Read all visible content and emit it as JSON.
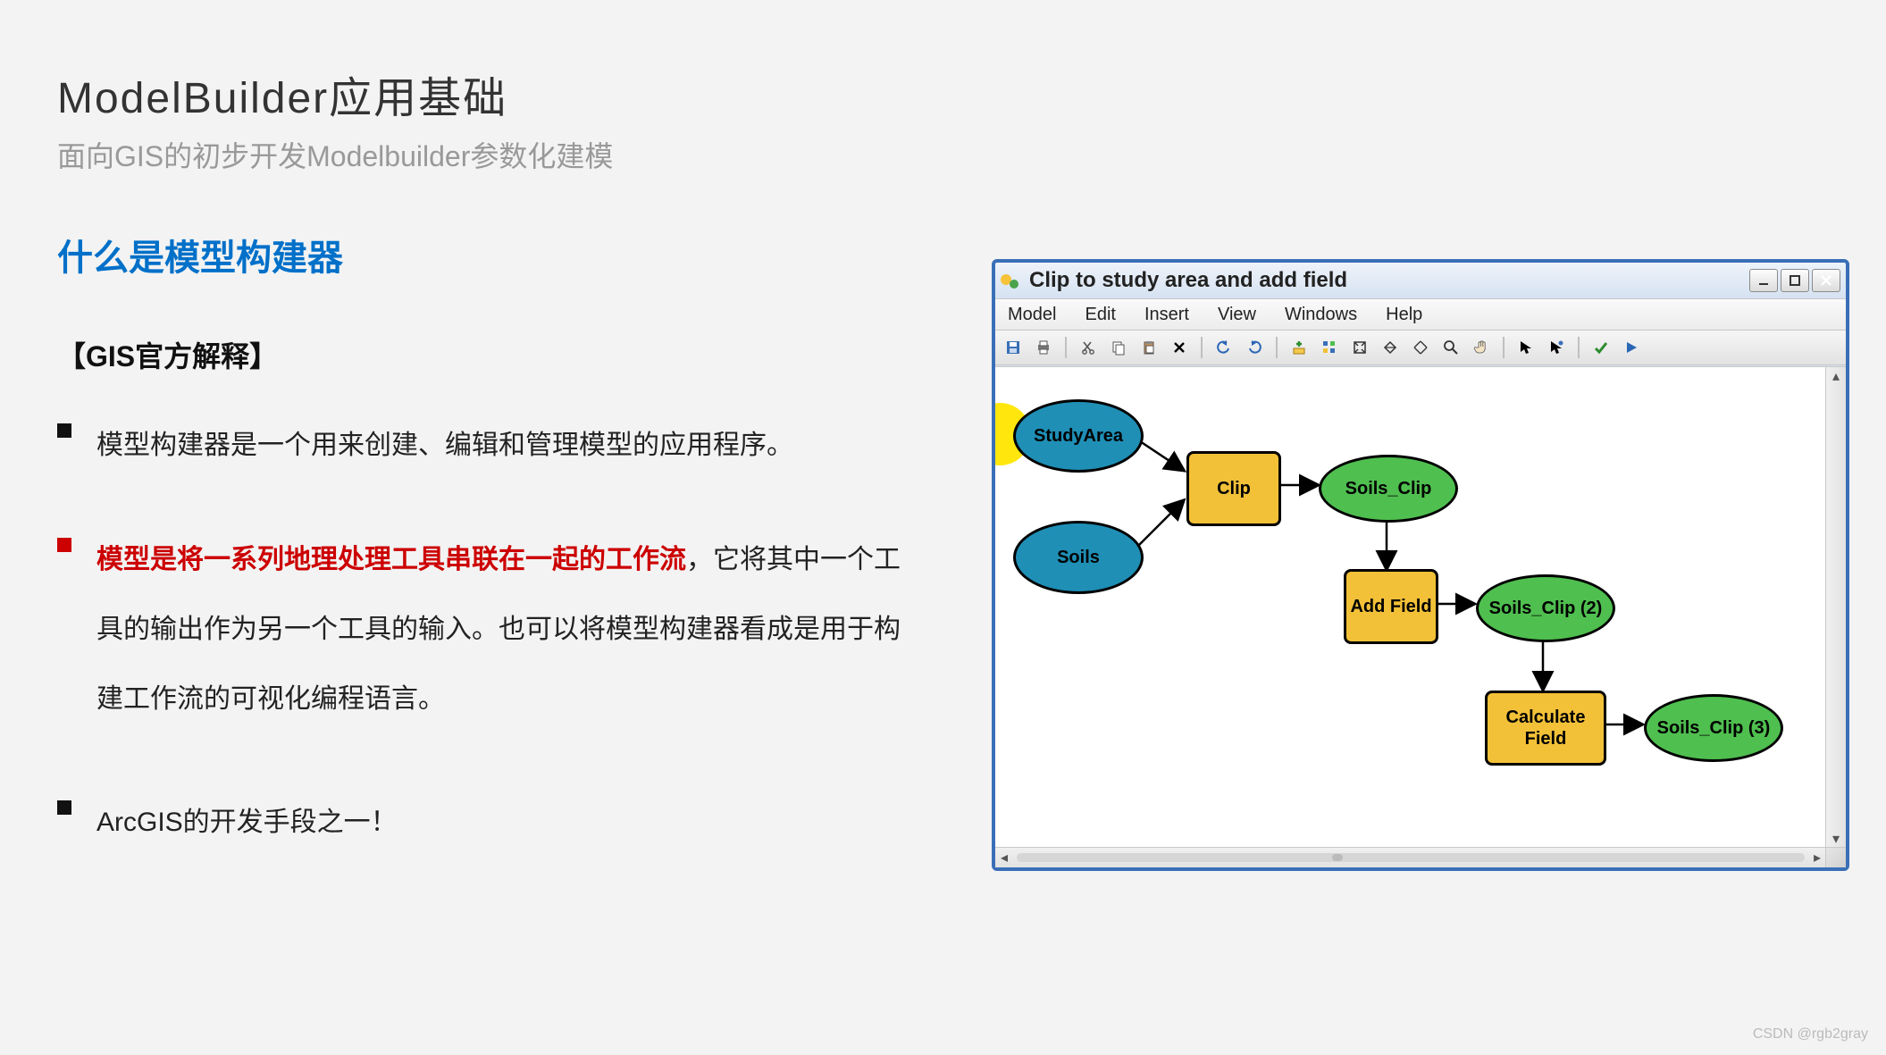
{
  "slide": {
    "main_title": "ModelBuilder应用基础",
    "subtitle": "面向GIS的初步开发Modelbuilder参数化建模",
    "section_title": "什么是模型构建器",
    "sub_section": "【GIS官方解释】",
    "bullets": {
      "b1": "模型构建器是一个用来创建、编辑和管理模型的应用程序。",
      "b2_hl": "模型是将一系列地理处理工具串联在一起的工作流",
      "b2_rest": "，它将其中一个工具的输出作为另一个工具的输入。也可以将模型构建器看成是用于构建工作流的可视化编程语言。",
      "b3": "ArcGIS的开发手段之一！"
    }
  },
  "mb": {
    "window_title": "Clip to study area and add field",
    "menus": [
      "Model",
      "Edit",
      "Insert",
      "View",
      "Windows",
      "Help"
    ],
    "toolbar_icons": [
      "save-icon",
      "print-icon",
      "cut-icon",
      "copy-icon",
      "paste-icon",
      "delete-icon",
      "undo-icon",
      "redo-icon",
      "add-data-icon",
      "auto-layout-icon",
      "full-extent-icon",
      "fixed-zoom-in-icon",
      "fixed-zoom-out-icon",
      "zoom-icon",
      "pan-icon",
      "select-icon",
      "connect-icon",
      "validate-icon",
      "run-icon"
    ],
    "nodes": {
      "study_area": "StudyArea",
      "soils": "Soils",
      "clip": "Clip",
      "soils_clip": "Soils_Clip",
      "add_field": "Add Field",
      "soils_clip2": "Soils_Clip (2)",
      "calc_field": "Calculate Field",
      "soils_clip3": "Soils_Clip (3)"
    }
  },
  "watermark": "CSDN @rgb2gray",
  "chart_data": {
    "type": "diagram",
    "description": "ArcGIS ModelBuilder geoprocessing workflow",
    "nodes": [
      {
        "id": "StudyArea",
        "type": "input",
        "shape": "ellipse",
        "color": "blue"
      },
      {
        "id": "Soils",
        "type": "input",
        "shape": "ellipse",
        "color": "blue"
      },
      {
        "id": "Clip",
        "type": "tool",
        "shape": "rect",
        "color": "yellow"
      },
      {
        "id": "Soils_Clip",
        "type": "output",
        "shape": "ellipse",
        "color": "green"
      },
      {
        "id": "Add Field",
        "type": "tool",
        "shape": "rect",
        "color": "yellow"
      },
      {
        "id": "Soils_Clip (2)",
        "type": "output",
        "shape": "ellipse",
        "color": "green"
      },
      {
        "id": "Calculate Field",
        "type": "tool",
        "shape": "rect",
        "color": "yellow"
      },
      {
        "id": "Soils_Clip (3)",
        "type": "output",
        "shape": "ellipse",
        "color": "green"
      }
    ],
    "edges": [
      [
        "StudyArea",
        "Clip"
      ],
      [
        "Soils",
        "Clip"
      ],
      [
        "Clip",
        "Soils_Clip"
      ],
      [
        "Soils_Clip",
        "Add Field"
      ],
      [
        "Add Field",
        "Soils_Clip (2)"
      ],
      [
        "Soils_Clip (2)",
        "Calculate Field"
      ],
      [
        "Calculate Field",
        "Soils_Clip (3)"
      ]
    ]
  }
}
